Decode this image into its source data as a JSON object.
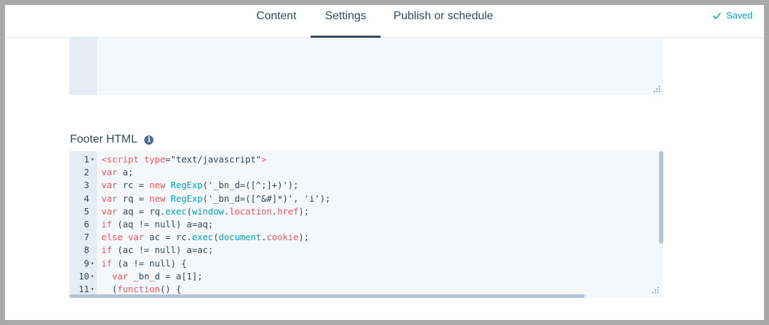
{
  "nav": {
    "tabs": [
      {
        "label": "Content"
      },
      {
        "label": "Settings"
      },
      {
        "label": "Publish or schedule"
      }
    ],
    "saved_label": "Saved"
  },
  "footer": {
    "label": "Footer HTML"
  },
  "editor": {
    "lines": [
      {
        "n": "1",
        "fold": true,
        "code": "<script type=\"text/javascript\">"
      },
      {
        "n": "2",
        "fold": false,
        "code": "var a;"
      },
      {
        "n": "3",
        "fold": false,
        "code": "var rc = new RegExp('_bn_d=([^;]+)');"
      },
      {
        "n": "4",
        "fold": false,
        "code": "var rq = new RegExp('_bn_d=([^&#]*)', 'i');"
      },
      {
        "n": "5",
        "fold": false,
        "code": "var aq = rq.exec(window.location.href);"
      },
      {
        "n": "6",
        "fold": false,
        "code": "if (aq != null) a=aq;"
      },
      {
        "n": "7",
        "fold": false,
        "code": "else var ac = rc.exec(document.cookie);"
      },
      {
        "n": "8",
        "fold": false,
        "code": "if (ac != null) a=ac;"
      },
      {
        "n": "9",
        "fold": true,
        "code": "if (a != null) {"
      },
      {
        "n": "10",
        "fold": true,
        "code": "  var _bn_d = a[1];"
      },
      {
        "n": "11",
        "fold": true,
        "code": "  (function() {"
      }
    ]
  },
  "colors": {
    "keyword": "#f2545b",
    "string": "#00a4bd",
    "text": "#33475b",
    "saved": "#00a4bd"
  }
}
